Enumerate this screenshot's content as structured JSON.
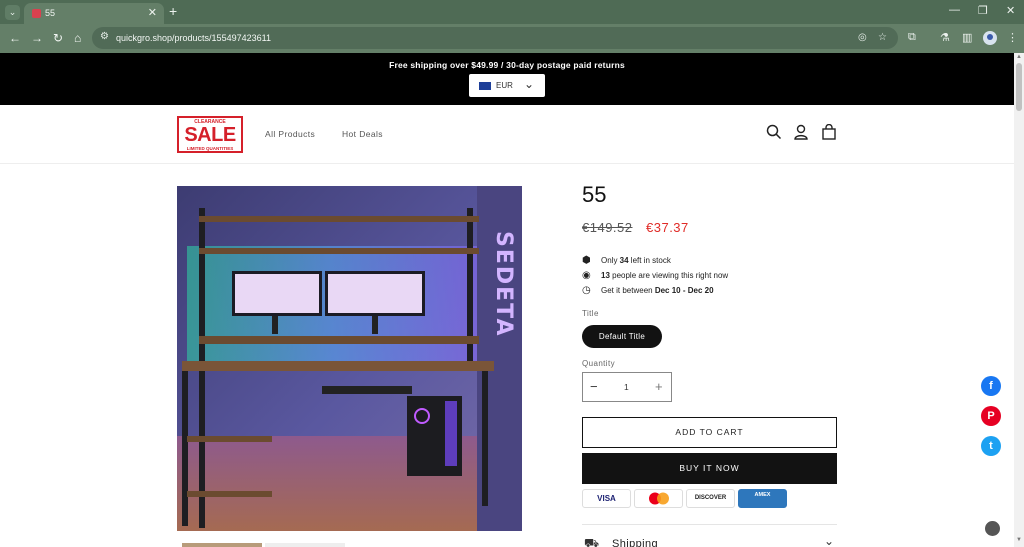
{
  "browser": {
    "tab_title": "55",
    "url": "quickgro.shop/products/155497423611"
  },
  "store": {
    "announcement": "Free shipping over $49.99 / 30-day postage paid returns",
    "currency": "EUR",
    "logo": {
      "top": "CLEARANCE",
      "main": "SALE",
      "bottom": "LIMITED QUANTITIES"
    },
    "nav": [
      "All Products",
      "Hot Deals"
    ]
  },
  "product": {
    "title": "55",
    "price_old": "€149.52",
    "price_new": "€37.37",
    "stock": {
      "pre": "Only ",
      "count": "34",
      "post": " left in stock"
    },
    "viewers": {
      "count": "13",
      "post": " people are viewing this right now"
    },
    "delivery": {
      "pre": "Get it between ",
      "range": "Dec 10 - Dec 20"
    },
    "variant_label": "Title",
    "variant_value": "Default Title",
    "quantity_label": "Quantity",
    "quantity": "1",
    "add_to_cart": "ADD TO CART",
    "buy_now": "BUY IT NOW",
    "payments": [
      "VISA",
      "MC",
      "DISCOVER",
      "AMEX"
    ],
    "shipping_label": "Shipping",
    "image_brand": "SEDETA"
  },
  "colors": {
    "price_sale": "#e02b27",
    "facebook": "#1877f2",
    "pinterest": "#e60023",
    "twitter": "#1da1f2"
  },
  "icons": {
    "stock": "box-icon",
    "viewers": "eye-icon",
    "delivery": "clock-icon"
  }
}
